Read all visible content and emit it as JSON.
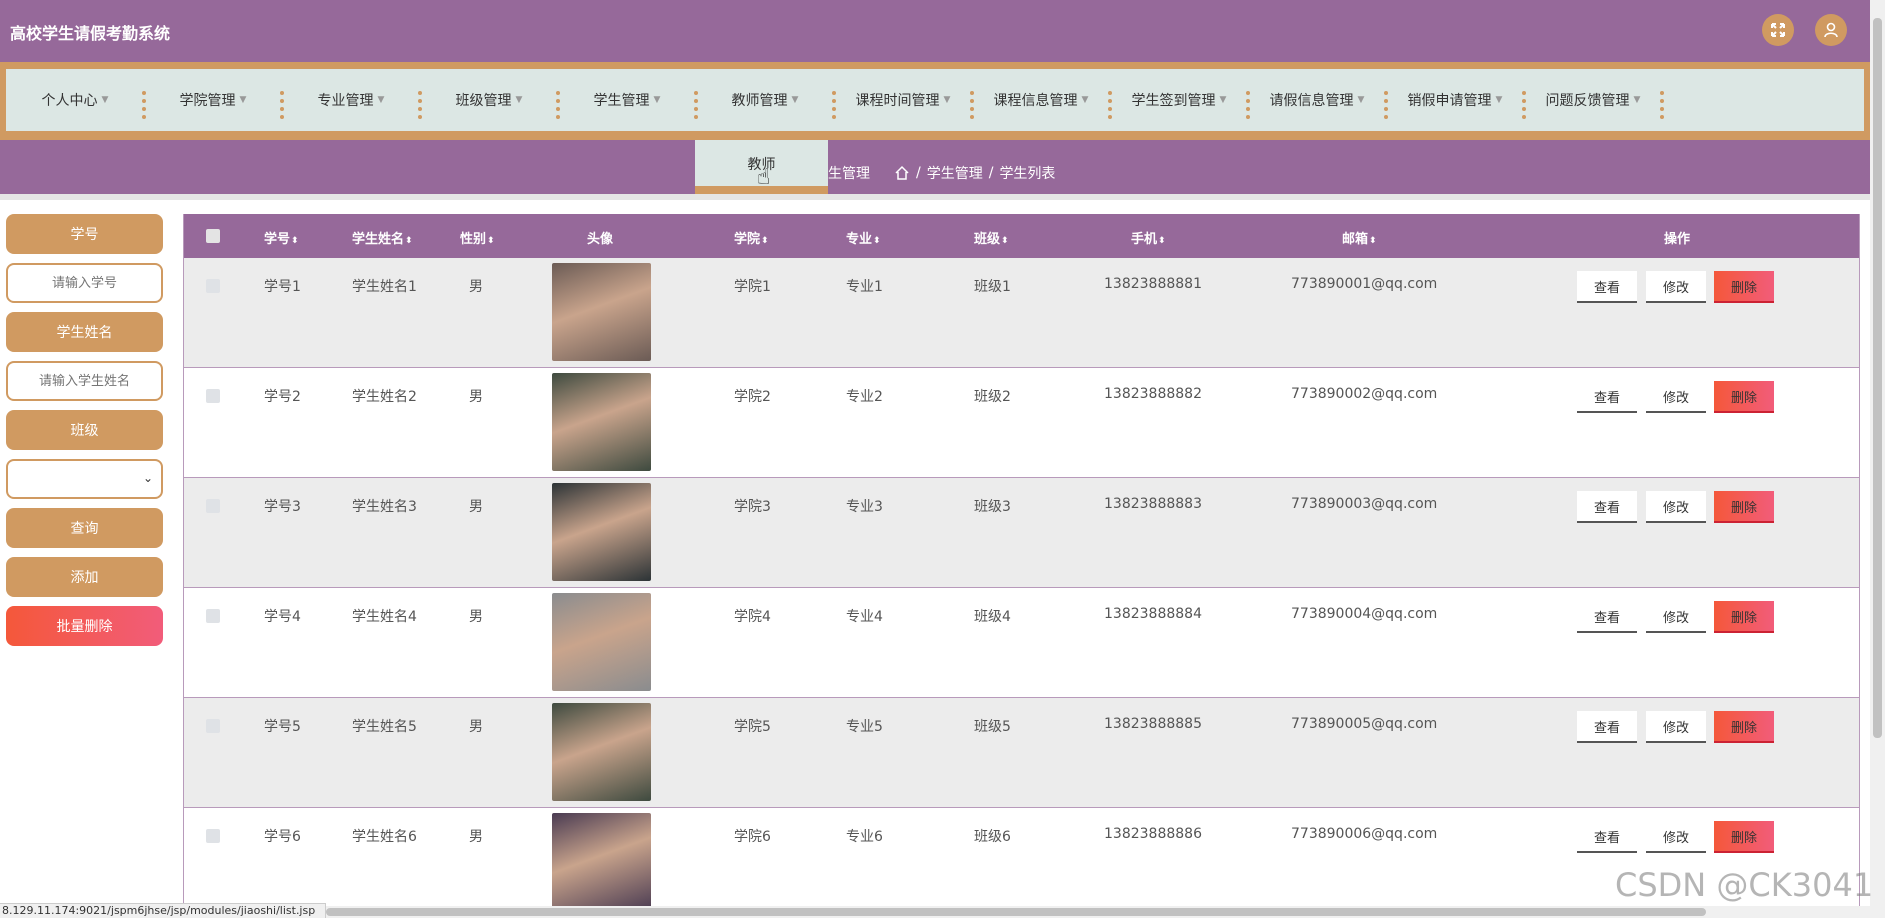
{
  "app": {
    "title": "高校学生请假考勤系统"
  },
  "nav": {
    "items": [
      {
        "label": "个人中心"
      },
      {
        "label": "学院管理"
      },
      {
        "label": "专业管理"
      },
      {
        "label": "班级管理"
      },
      {
        "label": "学生管理"
      },
      {
        "label": "教师管理"
      },
      {
        "label": "课程时间管理"
      },
      {
        "label": "课程信息管理"
      },
      {
        "label": "学生签到管理"
      },
      {
        "label": "请假信息管理"
      },
      {
        "label": "销假申请管理"
      },
      {
        "label": "问题反馈管理"
      }
    ],
    "dropdown_item": "教师"
  },
  "breadcrumb": {
    "partial_title": "生管理",
    "path1": "学生管理",
    "path2": "学生列表"
  },
  "search": {
    "field1_label": "学号",
    "field1_placeholder": "请输入学号",
    "field2_label": "学生姓名",
    "field2_placeholder": "请输入学生姓名",
    "field3_label": "班级",
    "field3_value": "",
    "query_button": "查询",
    "add_button": "添加",
    "batch_delete_button": "批量删除"
  },
  "table": {
    "columns": {
      "id": "学号",
      "name": "学生姓名",
      "gender": "性别",
      "avatar": "头像",
      "college": "学院",
      "major": "专业",
      "class": "班级",
      "phone": "手机",
      "email": "邮箱",
      "actions": "操作"
    },
    "sort_glyph": "⬍",
    "action_labels": {
      "view": "查看",
      "edit": "修改",
      "delete": "删除"
    },
    "rows": [
      {
        "id": "学号1",
        "name": "学生姓名1",
        "gender": "男",
        "college": "学院1",
        "major": "专业1",
        "class": "班级1",
        "phone": "13823888881",
        "email": "773890001@qq.com",
        "avatar_color": "#6b5b55"
      },
      {
        "id": "学号2",
        "name": "学生姓名2",
        "gender": "男",
        "college": "学院2",
        "major": "专业2",
        "class": "班级2",
        "phone": "13823888882",
        "email": "773890002@qq.com",
        "avatar_color": "#3e4a3f"
      },
      {
        "id": "学号3",
        "name": "学生姓名3",
        "gender": "男",
        "college": "学院3",
        "major": "专业3",
        "class": "班级3",
        "phone": "13823888883",
        "email": "773890003@qq.com",
        "avatar_color": "#2c3336"
      },
      {
        "id": "学号4",
        "name": "学生姓名4",
        "gender": "男",
        "college": "学院4",
        "major": "专业4",
        "class": "班级4",
        "phone": "13823888884",
        "email": "773890004@qq.com",
        "avatar_color": "#8a8c8e"
      },
      {
        "id": "学号5",
        "name": "学生姓名5",
        "gender": "男",
        "college": "学院5",
        "major": "专业5",
        "class": "班级5",
        "phone": "13823888885",
        "email": "773890005@qq.com",
        "avatar_color": "#3e4a3f"
      },
      {
        "id": "学号6",
        "name": "学生姓名6",
        "gender": "男",
        "college": "学院6",
        "major": "专业6",
        "class": "班级6",
        "phone": "13823888886",
        "email": "773890006@qq.com",
        "avatar_color": "#4a3b52"
      }
    ]
  },
  "status_bar": {
    "url": "8.129.11.174:9021/jspm6jhse/jsp/modules/jiaoshi/list.jsp"
  },
  "watermark": "CSDN @CK3041",
  "icons": {
    "fullscreen": "fullscreen-icon",
    "user": "user-icon",
    "home": "home-icon"
  },
  "colors": {
    "primary": "#96699a",
    "accent": "#d09a61",
    "nav_bg": "#dce7e4",
    "danger": "#f4583a"
  }
}
